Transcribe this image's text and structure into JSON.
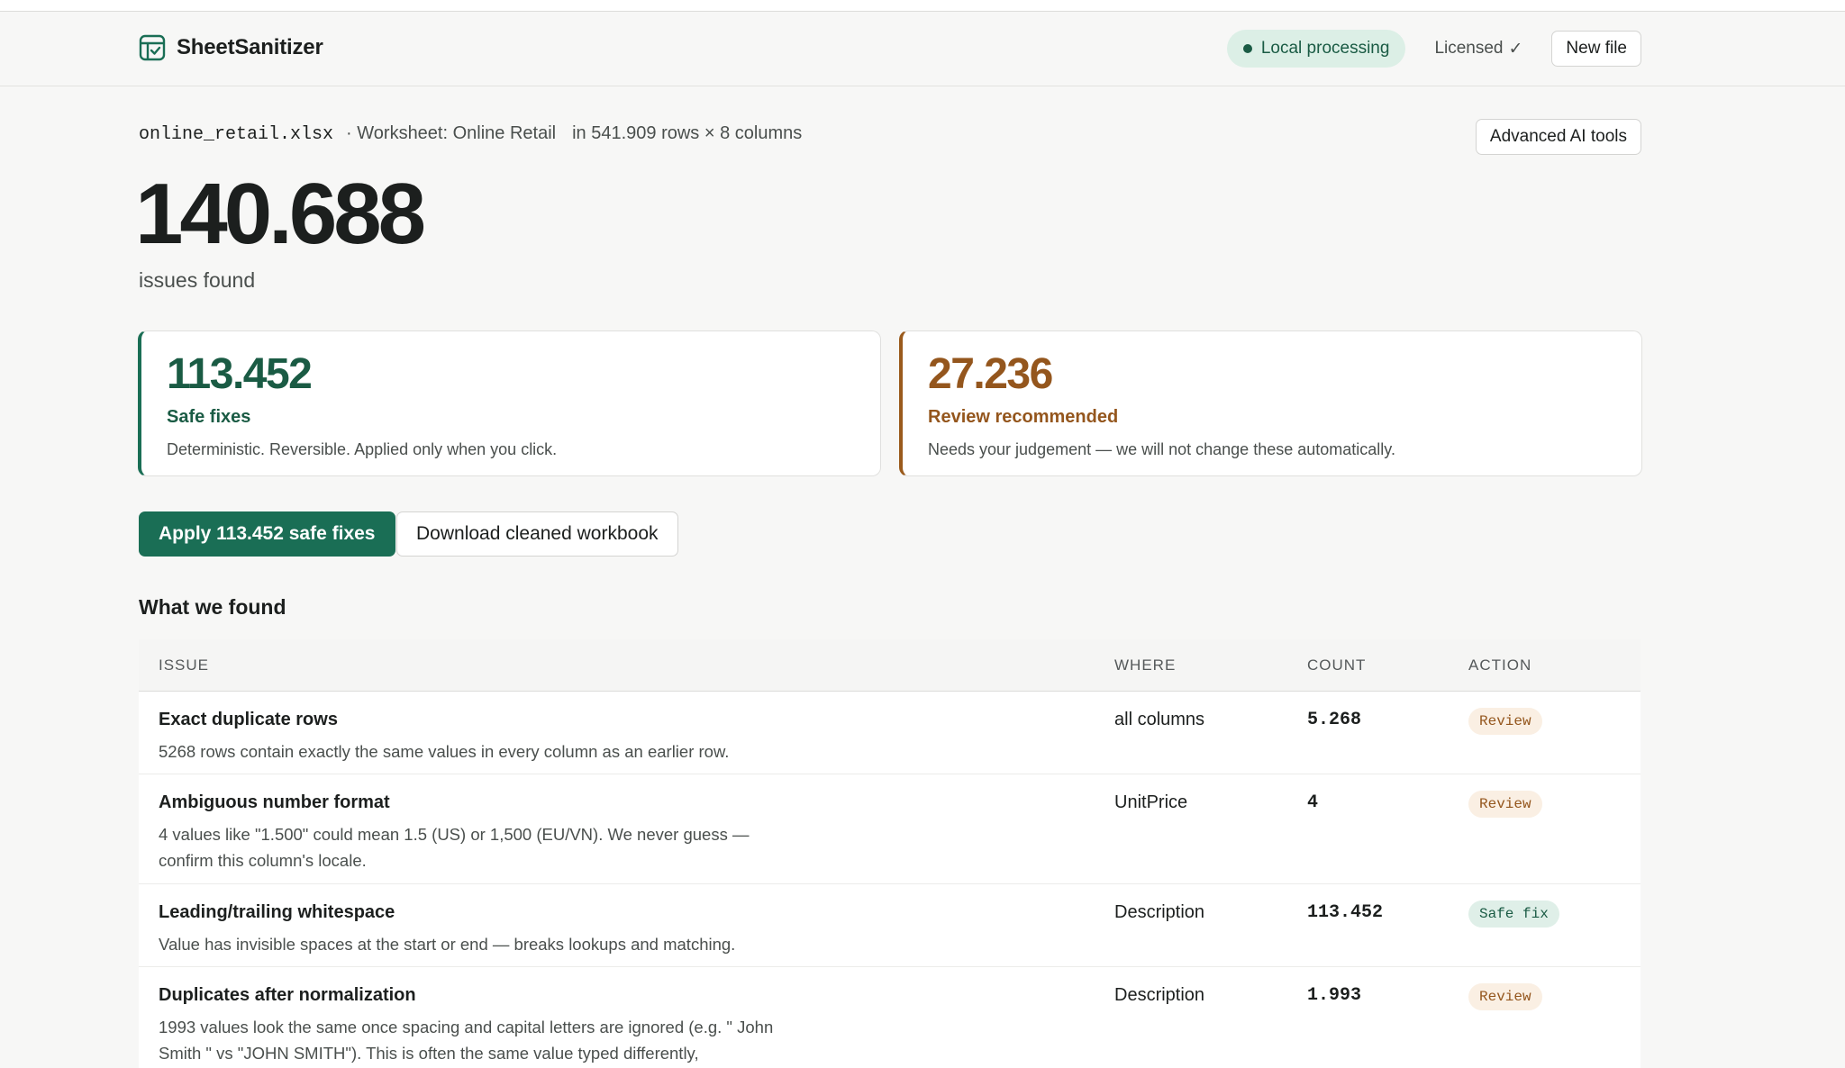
{
  "app": {
    "name": "SheetSanitizer",
    "local_processing": "Local processing",
    "licensed": "Licensed",
    "licensed_check": "✓",
    "new_file": "New file"
  },
  "file": {
    "name": "online_retail.xlsx",
    "worksheet": "· Worksheet: Online Retail",
    "dimensions": "in 541.909 rows × 8 columns",
    "advanced_ai": "Advanced AI tools"
  },
  "summary": {
    "total": "140.688",
    "total_label": "issues found",
    "safe": {
      "value": "113.452",
      "label": "Safe fixes",
      "desc": "Deterministic. Reversible. Applied only when you click."
    },
    "review": {
      "value": "27.236",
      "label": "Review recommended",
      "desc": "Needs your judgement — we will not change these automatically."
    }
  },
  "actions": {
    "apply": "Apply 113.452 safe fixes",
    "download": "Download cleaned workbook"
  },
  "findings": {
    "title": "What we found",
    "columns": [
      "ISSUE",
      "WHERE",
      "COUNT",
      "ACTION"
    ],
    "rows": [
      {
        "title": "Exact duplicate rows",
        "desc": "5268 rows contain exactly the same values in every column as an earlier row.",
        "where": "all columns",
        "count": "5.268",
        "action": "Review"
      },
      {
        "title": "Ambiguous number format",
        "desc": "4 values like \"1.500\" could mean 1.5 (US) or 1,500 (EU/VN). We never guess — confirm this column's locale.",
        "where": "UnitPrice",
        "count": "4",
        "action": "Review"
      },
      {
        "title": "Leading/trailing whitespace",
        "desc": "Value has invisible spaces at the start or end — breaks lookups and matching.",
        "where": "Description",
        "count": "113.452",
        "action": "Safe fix"
      },
      {
        "title": "Duplicates after normalization",
        "desc": "1993 values look the same once spacing and capital letters are ignored (e.g. \" John Smith \" vs \"JOHN SMITH\"). This is often the same value typed differently,",
        "where": "Description",
        "count": "1.993",
        "action": "Review"
      }
    ]
  },
  "colors": {
    "accent": "#1a6e55",
    "review": "#94561d"
  }
}
